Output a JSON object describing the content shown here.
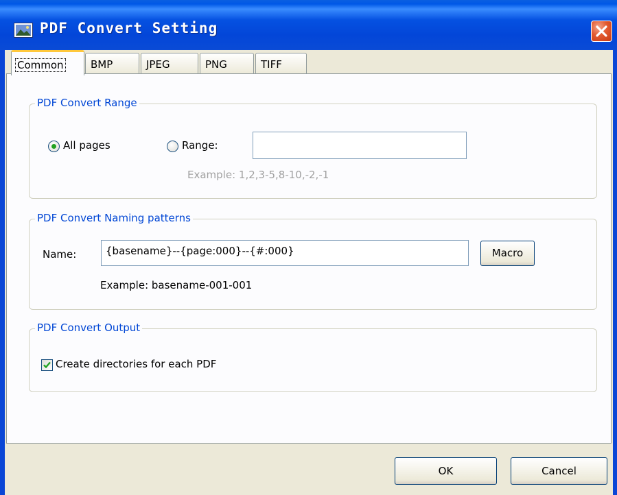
{
  "window": {
    "title": "PDF Convert Setting",
    "icon": "image-icon",
    "close_icon": "close-icon"
  },
  "tabs": [
    {
      "label": "Common",
      "active": true
    },
    {
      "label": "BMP",
      "active": false
    },
    {
      "label": "JPEG",
      "active": false
    },
    {
      "label": "PNG",
      "active": false
    },
    {
      "label": "TIFF",
      "active": false
    }
  ],
  "range_group": {
    "title": "PDF Convert Range",
    "all_pages_label": "All pages",
    "all_pages_selected": true,
    "range_label": "Range:",
    "range_selected": false,
    "range_value": "",
    "example": "Example: 1,2,3-5,8-10,-2,-1"
  },
  "naming_group": {
    "title": "PDF Convert Naming patterns",
    "name_label": "Name:",
    "name_value": "{basename}--{page:000}--{#:000}",
    "macro_button": "Macro",
    "example": "Example:  basename-001-001"
  },
  "output_group": {
    "title": "PDF Convert Output",
    "create_dirs_label": "Create directories for each PDF",
    "create_dirs_checked": true
  },
  "footer": {
    "ok": "OK",
    "cancel": "Cancel"
  },
  "colors": {
    "titlebar": "#0a46d6",
    "group_title": "#0046d5",
    "dialog_bg": "#ece9d8",
    "panel_bg": "#fcfcfe",
    "radio_dot": "#21a121",
    "check": "#21a121",
    "close_button": "#e2592f",
    "active_tab_accent": "#ffc83c"
  }
}
